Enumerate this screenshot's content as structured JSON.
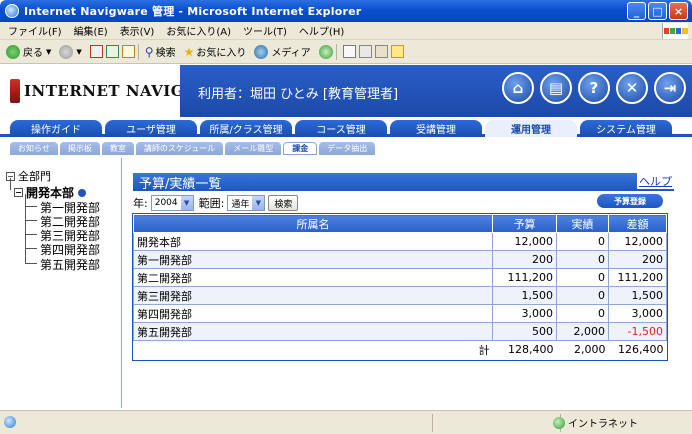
{
  "window": {
    "title": "Internet Navigware 管理 - Microsoft Internet Explorer",
    "buttons": [
      "_",
      "□",
      "×"
    ]
  },
  "menu": [
    "ファイル(F)",
    "編集(E)",
    "表示(V)",
    "お気に入り(A)",
    "ツール(T)",
    "ヘルプ(H)"
  ],
  "toolbar": {
    "back": "戻る",
    "search": "検索",
    "favorites": "お気に入り",
    "media": "メディア"
  },
  "header": {
    "logo": "INTERNET NAVIGWARE",
    "user_label": "利用者：堀田 ひとみ [教育管理者]",
    "icons": [
      "home-icon",
      "book-icon",
      "help-icon",
      "tools-icon",
      "exit-icon"
    ]
  },
  "tabs": [
    {
      "label": "操作ガイド",
      "active": false
    },
    {
      "label": "ユーザ管理",
      "active": false
    },
    {
      "label": "所属/クラス管理",
      "active": false
    },
    {
      "label": "コース管理",
      "active": false
    },
    {
      "label": "受講管理",
      "active": false
    },
    {
      "label": "運用管理",
      "active": true
    },
    {
      "label": "システム管理",
      "active": false
    }
  ],
  "subtabs": [
    {
      "label": "お知らせ",
      "active": false
    },
    {
      "label": "掲示板",
      "active": false
    },
    {
      "label": "教室",
      "active": false
    },
    {
      "label": "講師のスケジュール",
      "active": false
    },
    {
      "label": "メール雛型",
      "active": false
    },
    {
      "label": "課金",
      "active": true
    },
    {
      "label": "データ抽出",
      "active": false
    }
  ],
  "tree": {
    "root": "全部門",
    "node": "開発本部",
    "leaves": [
      "第一開発部",
      "第二開発部",
      "第三開発部",
      "第四開発部",
      "第五開発部"
    ]
  },
  "panel": {
    "title": "予算/実績一覧",
    "help": "ヘルプ",
    "year_label": "年:",
    "year_value": "2004",
    "range_label": "範囲:",
    "range_value": "通年",
    "search_button": "検索",
    "budget_button": "予算登録"
  },
  "table": {
    "headers": [
      "所属名",
      "予算",
      "実績",
      "差額"
    ],
    "rows": [
      {
        "name": "開発本部",
        "budget": "12,000",
        "actual": "0",
        "diff": "12,000",
        "negative": false
      },
      {
        "name": "第一開発部",
        "budget": "200",
        "actual": "0",
        "diff": "200",
        "negative": false
      },
      {
        "name": "第二開発部",
        "budget": "111,200",
        "actual": "0",
        "diff": "111,200",
        "negative": false
      },
      {
        "name": "第三開発部",
        "budget": "1,500",
        "actual": "0",
        "diff": "1,500",
        "negative": false
      },
      {
        "name": "第四開発部",
        "budget": "3,000",
        "actual": "0",
        "diff": "3,000",
        "negative": false
      },
      {
        "name": "第五開発部",
        "budget": "500",
        "actual": "2,000",
        "diff": "-1,500",
        "negative": true
      }
    ],
    "total": {
      "label": "計",
      "budget": "128,400",
      "actual": "2,000",
      "diff": "126,400"
    }
  },
  "status": {
    "zone": "イントラネット"
  }
}
